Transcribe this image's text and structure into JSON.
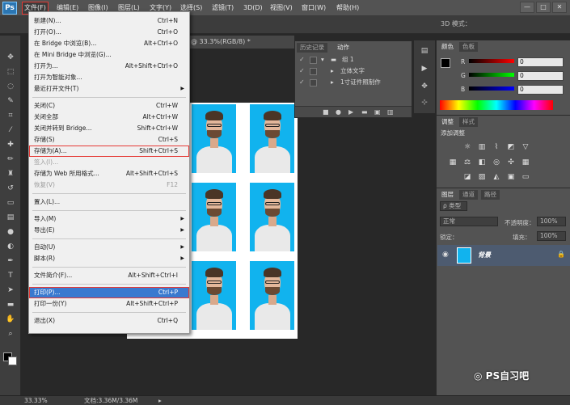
{
  "app": {
    "logo": "Ps"
  },
  "menubar": {
    "items": [
      "文件(F)",
      "编辑(E)",
      "图像(I)",
      "图层(L)",
      "文字(Y)",
      "选择(S)",
      "滤镜(T)",
      "3D(D)",
      "视图(V)",
      "窗口(W)",
      "帮助(H)"
    ]
  },
  "window_controls": [
    "—",
    "□",
    "✕"
  ],
  "options_bar": {
    "mode3d": "3D 模式："
  },
  "document": {
    "tab_label": "@ 33.3%(RGB/8) *",
    "photo_count": 9
  },
  "file_menu": {
    "items": [
      {
        "label": "新建(N)...",
        "shortcut": "Ctrl+N"
      },
      {
        "label": "打开(O)...",
        "shortcut": "Ctrl+O"
      },
      {
        "label": "在 Bridge 中浏览(B)...",
        "shortcut": "Alt+Ctrl+O"
      },
      {
        "label": "在 Mini Bridge 中浏览(G)...",
        "shortcut": ""
      },
      {
        "label": "打开为...",
        "shortcut": "Alt+Shift+Ctrl+O"
      },
      {
        "label": "打开为智能对象...",
        "shortcut": ""
      },
      {
        "label": "最近打开文件(T)",
        "shortcut": "",
        "submenu": true
      },
      {
        "label": "关闭(C)",
        "shortcut": "Ctrl+W"
      },
      {
        "label": "关闭全部",
        "shortcut": "Alt+Ctrl+W"
      },
      {
        "label": "关闭并转到 Bridge...",
        "shortcut": "Shift+Ctrl+W"
      },
      {
        "label": "存储(S)",
        "shortcut": "Ctrl+S"
      },
      {
        "label": "存储为(A)...",
        "shortcut": "Shift+Ctrl+S",
        "highlight": "red"
      },
      {
        "label": "签入(I)...",
        "shortcut": "",
        "disabled": true
      },
      {
        "label": "存储为 Web 所用格式...",
        "shortcut": "Alt+Shift+Ctrl+S"
      },
      {
        "label": "恢复(V)",
        "shortcut": "F12",
        "disabled": true
      },
      {
        "label": "置入(L)...",
        "shortcut": ""
      },
      {
        "label": "导入(M)",
        "shortcut": "",
        "submenu": true
      },
      {
        "label": "导出(E)",
        "shortcut": "",
        "submenu": true
      },
      {
        "label": "自动(U)",
        "shortcut": "",
        "submenu": true
      },
      {
        "label": "脚本(R)",
        "shortcut": "",
        "submenu": true
      },
      {
        "label": "文件简介(F)...",
        "shortcut": "Alt+Shift+Ctrl+I"
      },
      {
        "label": "打印(P)...",
        "shortcut": "Ctrl+P",
        "highlight": "blue"
      },
      {
        "label": "打印一份(Y)",
        "shortcut": "Alt+Shift+Ctrl+P"
      },
      {
        "label": "退出(X)",
        "shortcut": "Ctrl+Q"
      }
    ]
  },
  "history_panel": {
    "tabs": [
      "历史记录",
      "动作"
    ],
    "rows": [
      "组 1",
      "立体文字",
      "1寸证件照制作"
    ]
  },
  "color_panel": {
    "tabs": [
      "颜色",
      "色板"
    ],
    "channels": [
      {
        "label": "R",
        "value": "0"
      },
      {
        "label": "G",
        "value": "0"
      },
      {
        "label": "B",
        "value": "0"
      }
    ]
  },
  "adjustments_panel": {
    "tabs": [
      "调整",
      "样式"
    ],
    "title": "添加调整"
  },
  "layers_panel": {
    "tabs": [
      "图层",
      "通道",
      "路径"
    ],
    "kind_filter": "ρ 类型",
    "blend_mode": "正常",
    "opacity_label": "不透明度：",
    "opacity_value": "100%",
    "lock_label": "锁定：",
    "fill_label": "填充：",
    "fill_value": "100%",
    "layer_name": "背景"
  },
  "statusbar": {
    "zoom": "33.33%",
    "doc_info": "文档:3.36M/3.36M"
  },
  "watermark": "PS自习吧",
  "colors": {
    "accent_blue": "#3a79cf",
    "highlight_red": "#e53935",
    "photo_bg": "#11b3ee"
  }
}
